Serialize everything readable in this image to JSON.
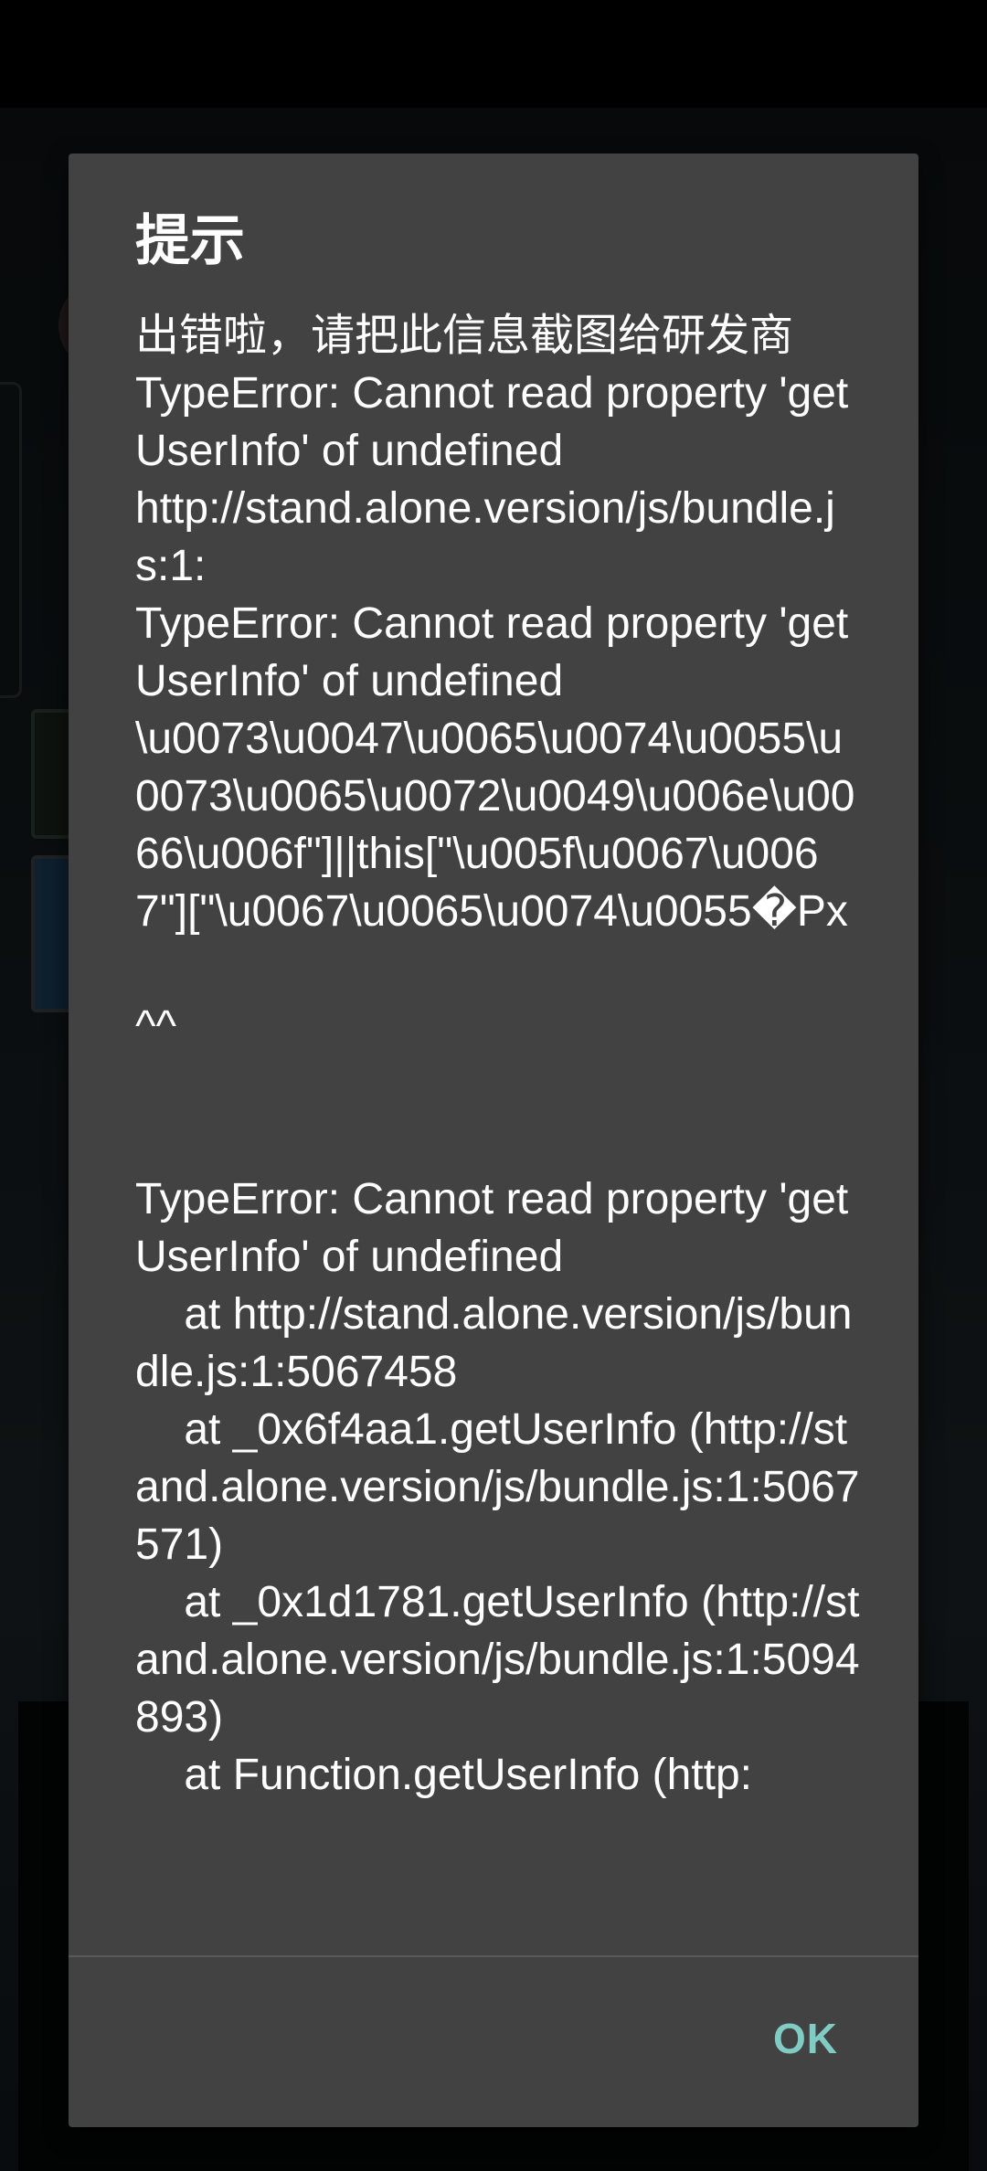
{
  "dialog": {
    "title": "提示",
    "message": "出错啦，请把此信息截图给研发商\nTypeError: Cannot read property 'getUserInfo' of undefined\nhttp://stand.alone.version/js/bundle.js:1:\nTypeError: Cannot read property 'getUserInfo' of undefined\n\\u0073\\u0047\\u0065\\u0074\\u0055\\u0073\\u0065\\u0072\\u0049\\u006e\\u0066\\u006f\"]||this[\"\\u005f\\u0067\\u0067\"][\"\\u0067\\u0065\\u0074\\u0055�Px\n\n^^\n\n\nTypeError: Cannot read property 'getUserInfo' of undefined\n    at http://stand.alone.version/js/bundle.js:1:5067458\n    at _0x6f4aa1.getUserInfo (http://stand.alone.version/js/bundle.js:1:5067571)\n    at _0x1d1781.getUserInfo (http://stand.alone.version/js/bundle.js:1:5094893)\n    at Function.getUserInfo (http:",
    "ok_label": "OK"
  },
  "colors": {
    "dialog_background": "#424242",
    "accent": "#80cbc4",
    "text": "#ffffff"
  }
}
